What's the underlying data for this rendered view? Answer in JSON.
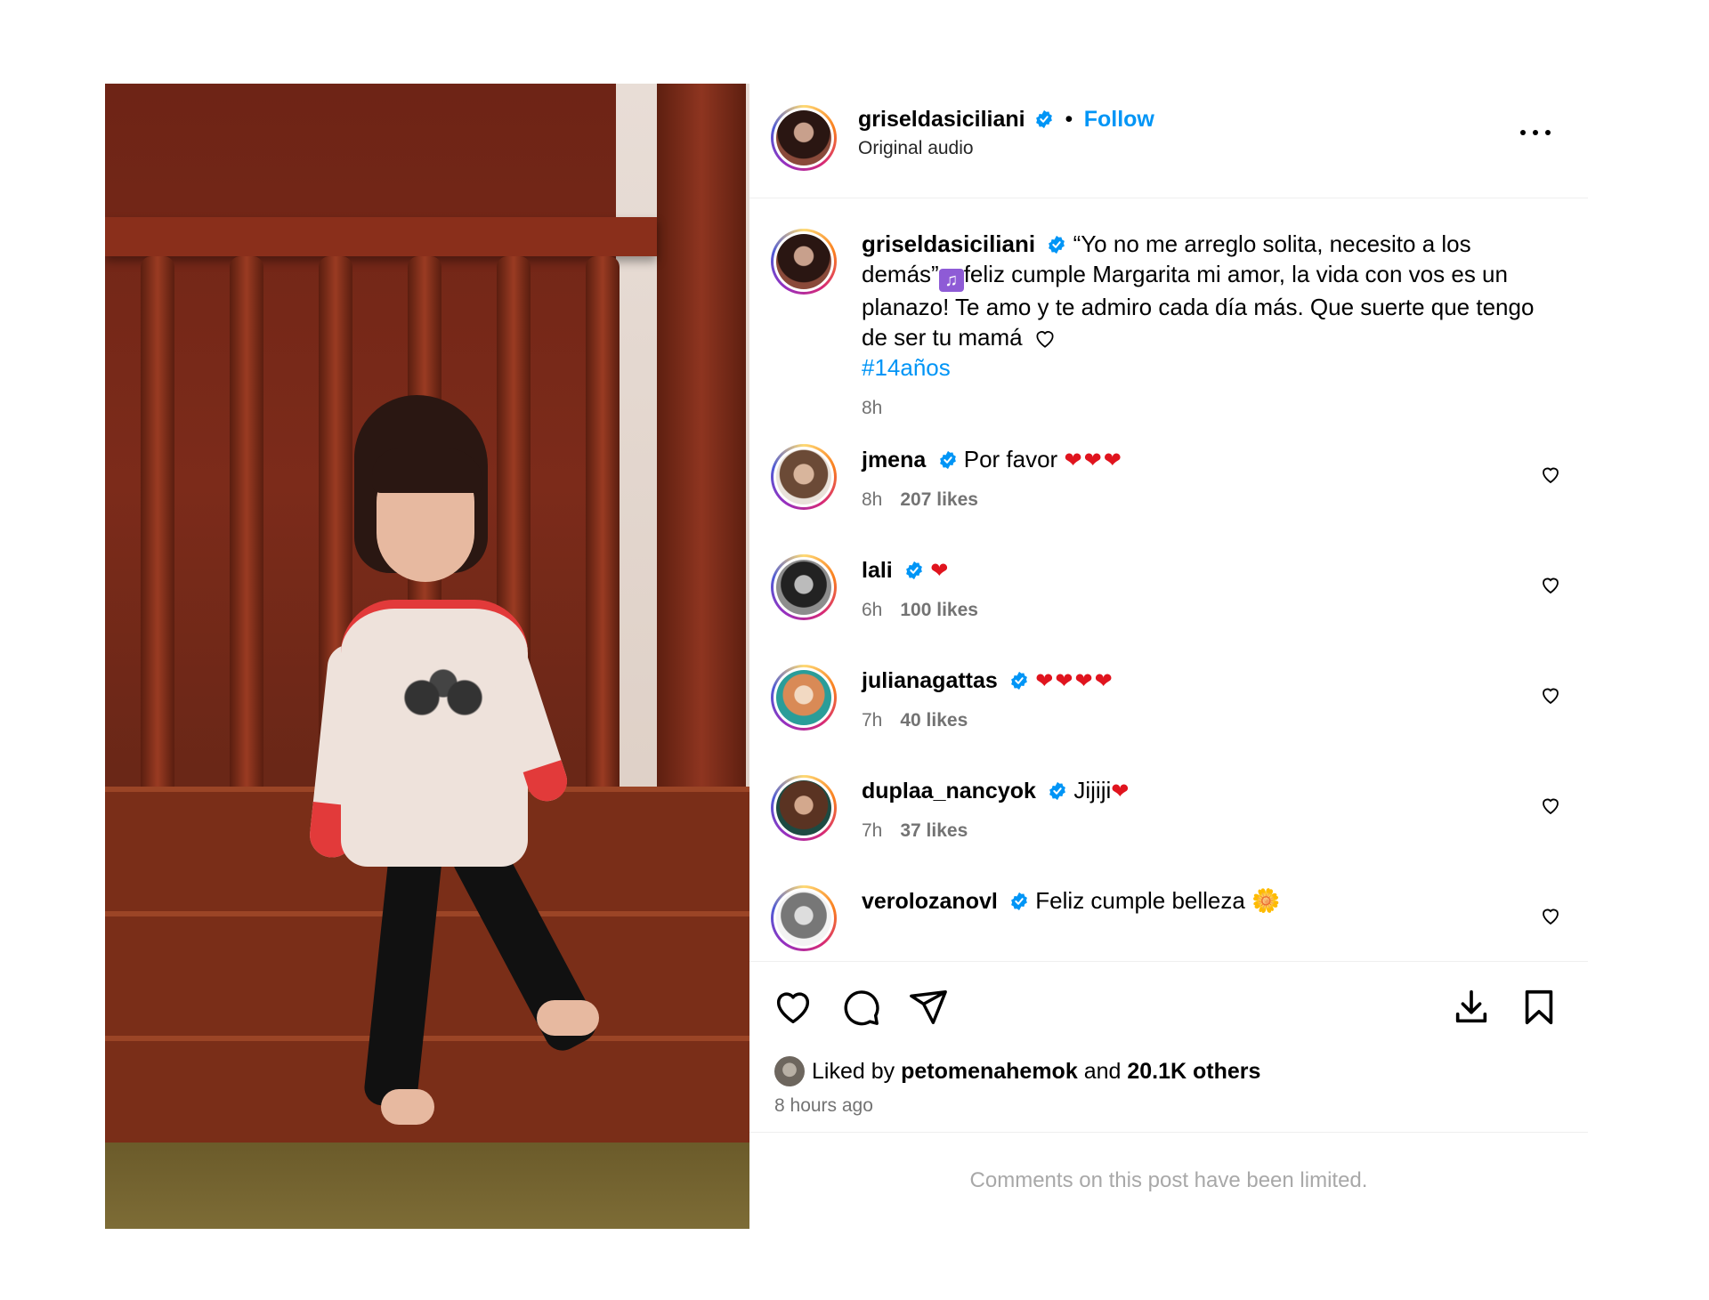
{
  "post": {
    "username": "griseldasiciliani",
    "follow_label": "Follow",
    "separator": "•",
    "audio": "Original audio",
    "caption": {
      "username": "griseldasiciliani",
      "text_1": "“Yo no me arreglo solita, necesito a los demás”",
      "text_2": "feliz cumple Margarita mi amor, la vida con vos es un planazo! Te amo y te admiro cada día más. Que suerte que tengo de ser tu mamá",
      "hashtag": "#14años",
      "time": "8h"
    },
    "comments": [
      {
        "username": "jmena",
        "text": "Por favor",
        "emoji": "❤❤❤",
        "time": "8h",
        "likes": "207 likes"
      },
      {
        "username": "lali",
        "text": "",
        "emoji": "❤",
        "time": "6h",
        "likes": "100 likes"
      },
      {
        "username": "julianagattas",
        "text": "",
        "emoji": "❤❤❤❤",
        "time": "7h",
        "likes": "40 likes"
      },
      {
        "username": "duplaa_nancyok",
        "text": "Jijiji",
        "emoji": "❤",
        "time": "7h",
        "likes": "37 likes"
      },
      {
        "username": "verolozanovl",
        "text": "Feliz cumple belleza",
        "emoji": "🌼"
      }
    ],
    "liked_prefix": "Liked by",
    "liked_user": "petomenahemok",
    "liked_and": "and",
    "liked_others": "20.1K others",
    "time_ago": "8 hours ago",
    "limited_notice": "Comments on this post have been limited."
  },
  "icons": {
    "verified": "verified-badge-icon",
    "more": "more-options-icon",
    "like": "heart-icon",
    "comment": "comment-icon",
    "share": "share-icon",
    "download": "download-icon",
    "save": "bookmark-icon",
    "mute": "muted-speaker-icon"
  },
  "colors": {
    "accent": "#0095f6",
    "verified": "#0095f6",
    "heart": "#e0141e",
    "secondary_text": "#737373"
  }
}
